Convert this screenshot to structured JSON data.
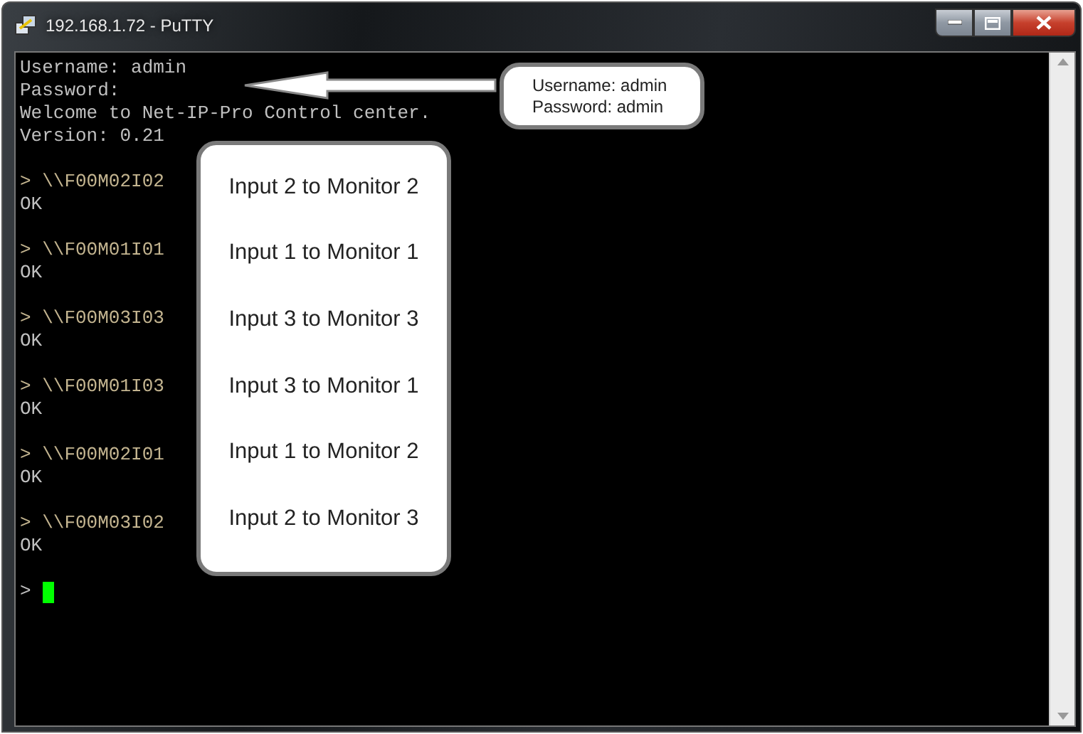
{
  "window": {
    "title": "192.168.1.72 - PuTTY"
  },
  "terminal": {
    "intro": [
      "Username: admin",
      "Password:",
      "Welcome to Net-IP-Pro Control center.",
      "Version: 0.21"
    ],
    "commands": [
      {
        "command": "> \\\\F00M02I02",
        "response": "OK"
      },
      {
        "command": "> \\\\F00M01I01",
        "response": "OK"
      },
      {
        "command": "> \\\\F00M03I03",
        "response": "OK"
      },
      {
        "command": "> \\\\F00M01I03",
        "response": "OK"
      },
      {
        "command": "> \\\\F00M02I01",
        "response": "OK"
      },
      {
        "command": "> \\\\F00M03I02",
        "response": "OK"
      }
    ],
    "prompt": {
      "text": ">",
      "cursor": true
    }
  },
  "annotations": {
    "credentials_note": [
      "Username: admin",
      "Password: admin"
    ],
    "mapping_note": [
      "Input 2 to Monitor 2",
      "Input 1 to Monitor 1",
      "Input 3 to Monitor 3",
      "Input 3 to Monitor 1",
      "Input 1 to Monitor 2",
      "Input 2 to Monitor 3"
    ]
  }
}
